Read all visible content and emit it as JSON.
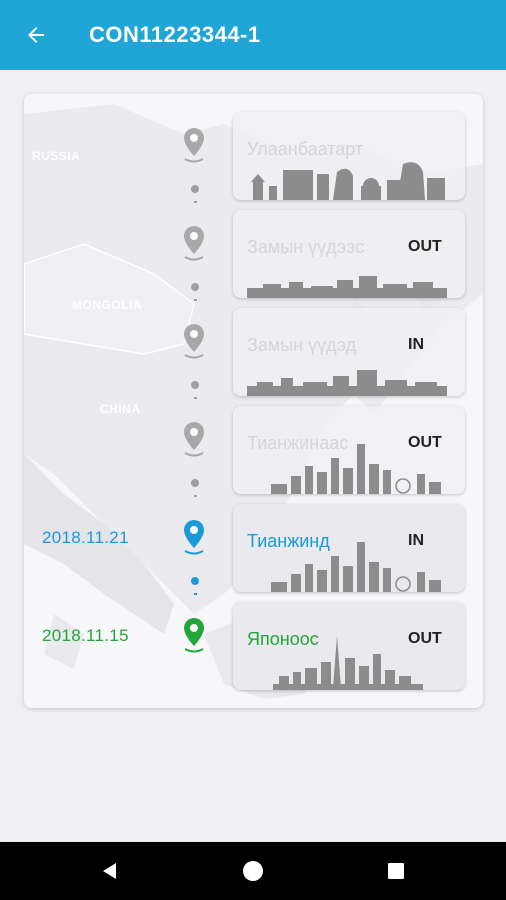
{
  "header": {
    "title": "CON11223344-1",
    "back_icon": "arrow-left-icon"
  },
  "map": {
    "labels": [
      "RUSSIA",
      "MONGOLIA",
      "CHINA"
    ]
  },
  "colors": {
    "accent": "#1fa6d6",
    "blue": "#1a9ad6",
    "green": "#22a539",
    "pin_gray": "#9e9e9e"
  },
  "stops": [
    {
      "place": "Улаанбаатарт",
      "direction": "",
      "date": "",
      "status": "pending"
    },
    {
      "place": "Замын үүдээс",
      "direction": "OUT",
      "date": "",
      "status": "pending"
    },
    {
      "place": "Замын үүдэд",
      "direction": "IN",
      "date": "",
      "status": "pending"
    },
    {
      "place": "Тианжинаас",
      "direction": "OUT",
      "date": "",
      "status": "pending"
    },
    {
      "place": "Тианжинд",
      "direction": "IN",
      "date": "2018.11.21",
      "status": "current"
    },
    {
      "place": "Японоос",
      "direction": "OUT",
      "date": "2018.11.15",
      "status": "done"
    }
  ],
  "navbar": {
    "back": "triangle-back-icon",
    "home": "circle-home-icon",
    "recents": "square-recents-icon"
  }
}
